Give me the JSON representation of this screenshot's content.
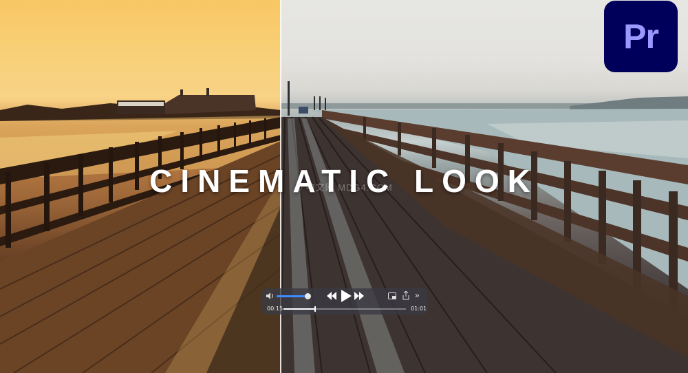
{
  "overlay": {
    "title": "CINEMATIC LOOK",
    "watermark": "© 中文网 MDG4.COM"
  },
  "badge": {
    "text": "Pr",
    "bg": "#00005b",
    "fg": "#9999ff"
  },
  "player": {
    "volume_level": 0.9,
    "current_time": "00:15",
    "end_time": "01:01",
    "progress": 0.25,
    "icons": {
      "volume": "speaker-icon",
      "rewind": "rewind-icon",
      "play": "play-icon",
      "forward": "fast-forward-icon",
      "pip": "picture-in-picture-icon",
      "share": "share-icon",
      "more": "more-icon"
    },
    "more_glyph": "»",
    "accent": "#3d8bff"
  }
}
